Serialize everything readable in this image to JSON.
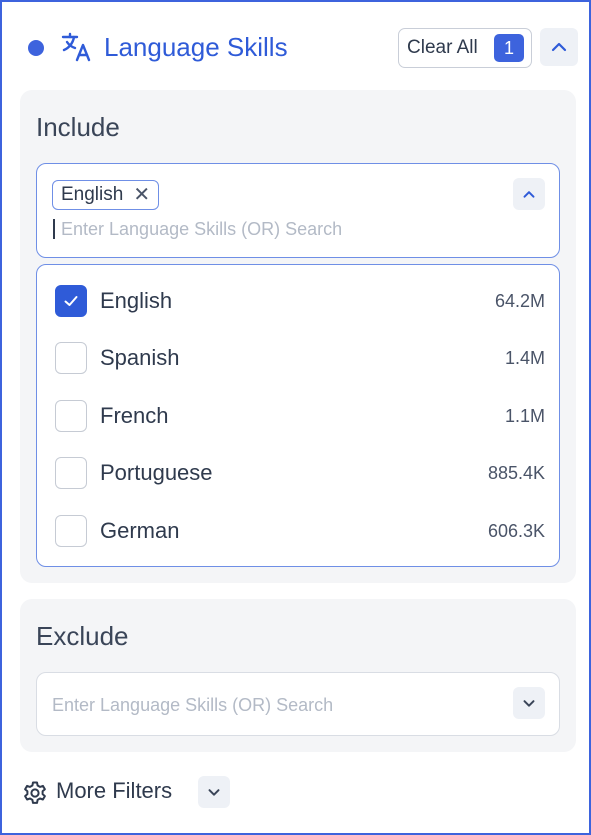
{
  "header": {
    "title": "Language Skills",
    "clear_all_label": "Clear All",
    "selected_count": "1"
  },
  "include": {
    "title": "Include",
    "chips": [
      {
        "label": "English"
      }
    ],
    "search_placeholder": "Enter Language Skills (OR) Search",
    "options": [
      {
        "label": "English",
        "count": "64.2M",
        "checked": true
      },
      {
        "label": "Spanish",
        "count": "1.4M",
        "checked": false
      },
      {
        "label": "French",
        "count": "1.1M",
        "checked": false
      },
      {
        "label": "Portuguese",
        "count": "885.4K",
        "checked": false
      },
      {
        "label": "German",
        "count": "606.3K",
        "checked": false
      }
    ]
  },
  "exclude": {
    "title": "Exclude",
    "search_placeholder": "Enter Language Skills (OR) Search"
  },
  "more_filters": {
    "label": "More Filters"
  },
  "colors": {
    "accent": "#3d63dd",
    "checked": "#2f5bd8"
  }
}
